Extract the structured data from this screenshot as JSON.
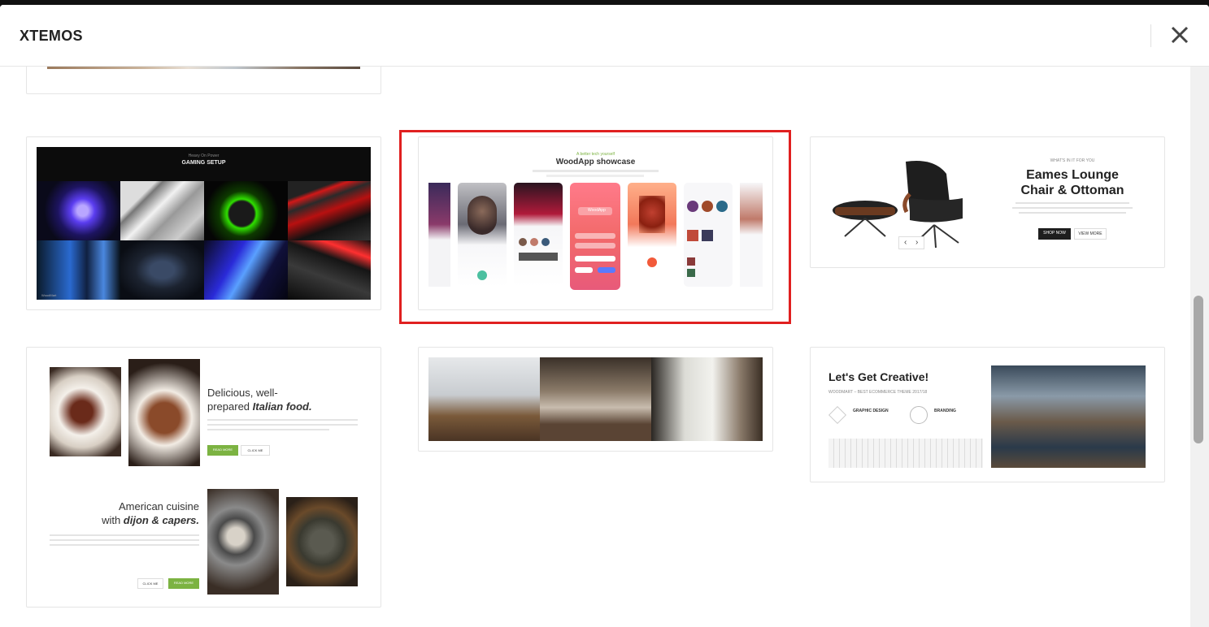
{
  "modal": {
    "title": "XTEMOS",
    "close_label": "✕"
  },
  "templates": [
    {
      "name": "gaming-setup",
      "kicker": "Heavy On Power",
      "heading": "GAMING SETUP",
      "brand": "WoodMart"
    },
    {
      "name": "woodapp-showcase",
      "kicker": "A better tech yourself",
      "heading": "WoodApp showcase",
      "phone_brand": "WoodApp",
      "selected": true
    },
    {
      "name": "eames-lounge",
      "kicker": "WHAT'S IN IT FOR YOU",
      "heading_line1": "Eames Lounge",
      "heading_line2": "Chair & Ottoman",
      "btn_primary": "SHOP NOW",
      "btn_secondary": "VIEW MORE"
    },
    {
      "name": "italian-food",
      "heading_line1": "Delicious, well-",
      "heading_line2a": "prepared ",
      "heading_line2b": "Italian food.",
      "btn_primary": "READ MORE",
      "btn_secondary": "CLICK ME",
      "heading2_line1": "American cuisine",
      "heading2_line2a": "with ",
      "heading2_line2b": "dijon & capers.",
      "btn2_primary": "READ MORE",
      "btn2_secondary": "CLICK ME"
    },
    {
      "name": "interior-collage"
    },
    {
      "name": "lets-get-creative",
      "heading": "Let's Get Creative!",
      "subheading": "WOODMART – BEST ECOMMERCE THEME 2017/18",
      "feature1": "GRAPHIC DESIGN",
      "feature2": "BRANDING"
    }
  ],
  "colors": {
    "selection": "#e02020",
    "accent_green": "#7cb342"
  }
}
